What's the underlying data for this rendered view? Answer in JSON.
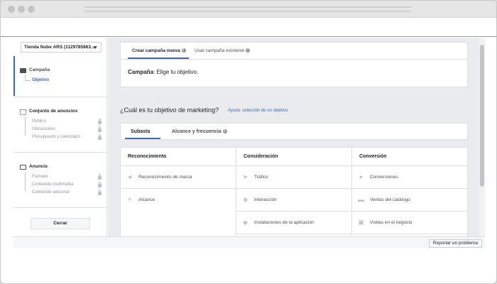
{
  "account": {
    "label": "Tienda Nube ARS (1129785863..."
  },
  "sidebar": {
    "campaign": {
      "title": "Campaña",
      "items": [
        "Objetivo"
      ]
    },
    "adset": {
      "title": "Conjunto de anuncios",
      "items": [
        "Público",
        "Ubicaciones",
        "Presupuesto y calendario"
      ]
    },
    "ad": {
      "title": "Anuncio",
      "items": [
        "Formato",
        "Contenido multimedia",
        "Contenido adicional"
      ]
    },
    "close_label": "Cerrar"
  },
  "campaign_card": {
    "tabs": [
      "Crear campaña nueva",
      "Usar campaña existente"
    ],
    "label_bold": "Campaña",
    "label_rest": ": Elige tu objetivo."
  },
  "objective": {
    "question": "¿Cuál es tu objetivo de marketing?",
    "help_link": "Ayuda: selección de un objetivo",
    "tabs": [
      "Subasta",
      "Alcance y frecuencia"
    ],
    "columns": [
      {
        "title": "Reconocimiento",
        "options": [
          {
            "label": "Reconocimiento de marca",
            "icon": "megaphone-icon"
          },
          {
            "label": "Alcance",
            "icon": "reach-icon"
          }
        ]
      },
      {
        "title": "Consideración",
        "options": [
          {
            "label": "Tráfico",
            "icon": "cursor-icon"
          },
          {
            "label": "Interacción",
            "icon": "people-icon"
          },
          {
            "label": "Instalaciones de la aplicación",
            "icon": "cube-icon"
          }
        ]
      },
      {
        "title": "Conversión",
        "options": [
          {
            "label": "Conversiones",
            "icon": "globe-icon"
          },
          {
            "label": "Ventas del catálogo",
            "icon": "cart-icon"
          },
          {
            "label": "Visitas en el negocio",
            "icon": "store-icon"
          }
        ]
      }
    ]
  },
  "footer": {
    "report_label": "Reportar un problema"
  },
  "colors": {
    "accent": "#4267b2",
    "link": "#4267b2",
    "bg": "#e9ebee"
  }
}
